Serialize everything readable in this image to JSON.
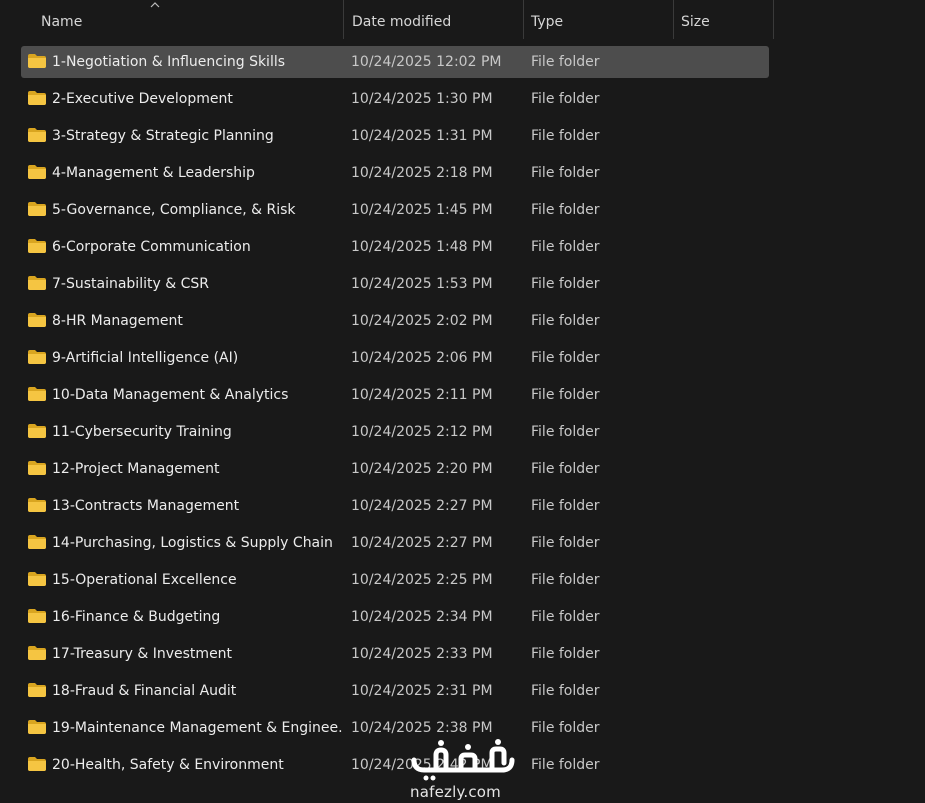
{
  "columns": {
    "name": "Name",
    "date_modified": "Date modified",
    "type": "Type",
    "size": "Size"
  },
  "sort": {
    "column": "name",
    "direction": "ascending",
    "icon": "sort-up-icon"
  },
  "folder_color": "#f5c542",
  "selected_color": "#4d4d4d",
  "rows": [
    {
      "name": "1-Negotiation & Influencing Skills",
      "date": "10/24/2025 12:02 PM",
      "type": "File folder",
      "size": "",
      "selected": true
    },
    {
      "name": "2-Executive Development",
      "date": "10/24/2025 1:30 PM",
      "type": "File folder",
      "size": ""
    },
    {
      "name": "3-Strategy & Strategic Planning",
      "date": "10/24/2025 1:31 PM",
      "type": "File folder",
      "size": ""
    },
    {
      "name": "4-Management & Leadership",
      "date": "10/24/2025 2:18 PM",
      "type": "File folder",
      "size": ""
    },
    {
      "name": "5-Governance, Compliance, & Risk",
      "date": "10/24/2025 1:45 PM",
      "type": "File folder",
      "size": ""
    },
    {
      "name": "6-Corporate Communication",
      "date": "10/24/2025 1:48 PM",
      "type": "File folder",
      "size": ""
    },
    {
      "name": "7-Sustainability & CSR",
      "date": "10/24/2025 1:53 PM",
      "type": "File folder",
      "size": ""
    },
    {
      "name": "8-HR Management",
      "date": "10/24/2025 2:02 PM",
      "type": "File folder",
      "size": ""
    },
    {
      "name": "9-Artificial Intelligence (AI)",
      "date": "10/24/2025 2:06 PM",
      "type": "File folder",
      "size": ""
    },
    {
      "name": "10-Data Management & Analytics",
      "date": "10/24/2025 2:11 PM",
      "type": "File folder",
      "size": ""
    },
    {
      "name": "11-Cybersecurity Training",
      "date": "10/24/2025 2:12 PM",
      "type": "File folder",
      "size": ""
    },
    {
      "name": "12-Project Management",
      "date": "10/24/2025 2:20 PM",
      "type": "File folder",
      "size": ""
    },
    {
      "name": "13-Contracts Management",
      "date": "10/24/2025 2:27 PM",
      "type": "File folder",
      "size": ""
    },
    {
      "name": "14-Purchasing, Logistics & Supply Chain",
      "date": "10/24/2025 2:27 PM",
      "type": "File folder",
      "size": ""
    },
    {
      "name": "15-Operational Excellence",
      "date": "10/24/2025 2:25 PM",
      "type": "File folder",
      "size": ""
    },
    {
      "name": "16-Finance & Budgeting",
      "date": "10/24/2025 2:34 PM",
      "type": "File folder",
      "size": ""
    },
    {
      "name": "17-Treasury & Investment",
      "date": "10/24/2025 2:33 PM",
      "type": "File folder",
      "size": ""
    },
    {
      "name": "18-Fraud & Financial Audit",
      "date": "10/24/2025 2:31 PM",
      "type": "File folder",
      "size": ""
    },
    {
      "name": "19-Maintenance Management & Enginee...",
      "date": "10/24/2025 2:38 PM",
      "type": "File folder",
      "size": ""
    },
    {
      "name": "20-Health, Safety & Environment",
      "date": "10/24/2025 2:42 PM",
      "type": "File folder",
      "size": ""
    }
  ],
  "watermark": {
    "arabic": "نفذلي",
    "latin": "nafezly.com"
  }
}
